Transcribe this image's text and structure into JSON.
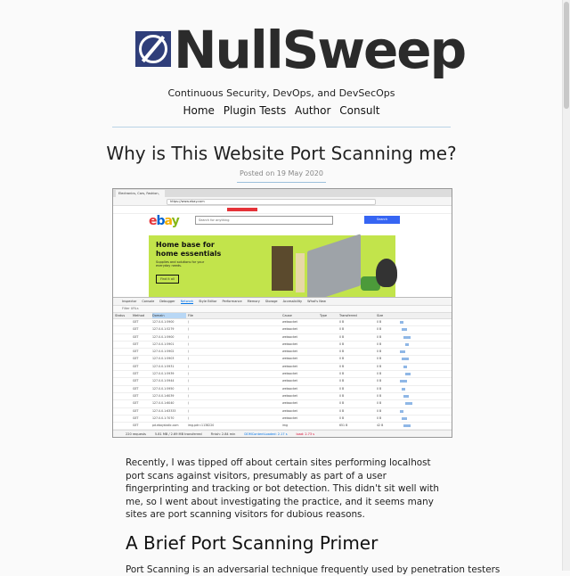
{
  "site": {
    "name": "NullSweep",
    "tagline": "Continuous Security, DevOps, and DevSecOps",
    "nav": [
      "Home",
      "Plugin Tests",
      "Author",
      "Consult"
    ]
  },
  "post": {
    "title": "Why is This Website Port Scanning me?",
    "date": "Posted on 19 May 2020",
    "intro": "Recently, I was tipped off about certain sites performing localhost port scans against visitors, presumably as part of a user fingerprinting and tracking or bot detection. This didn't sit well with me, so I went about investigating the practice, and it seems many sites are port scanning visitors for dubious reasons.",
    "section_heading": "A Brief Port Scanning Primer",
    "section_intro_partial": "Port Scanning is an adversarial technique frequently used by penetration testers"
  },
  "screenshot": {
    "tab_title": "Electronics, Cars, Fashion, Col...",
    "url": "https://www.ebay.com",
    "search_placeholder": "Search for anything",
    "search_button": "Search",
    "register_label": "Don't miss out: R 10 on",
    "banner_heading_1": "Home base for",
    "banner_heading_2": "home essentials",
    "banner_sub": "Supplies and solutions for your everyday needs.",
    "banner_cta": "Find it all",
    "devtools_tabs": [
      "Inspector",
      "Console",
      "Debugger",
      "Network",
      "Style Editor",
      "Performance",
      "Memory",
      "Storage",
      "Accessibility",
      "What's New"
    ],
    "filter_placeholder": "Filter URLs",
    "columns": [
      "Status",
      "Method",
      "Domain",
      "File",
      "Cause",
      "Type",
      "Transferred",
      "Size"
    ],
    "rows": [
      {
        "method": "GET",
        "domain": "127.0.0.1:5900",
        "file": "/",
        "cause": "websocket",
        "trans": "0 B",
        "size": "0 B"
      },
      {
        "method": "GET",
        "domain": "127.0.0.1:5279",
        "file": "/",
        "cause": "websocket",
        "trans": "0 B",
        "size": "0 B"
      },
      {
        "method": "GET",
        "domain": "127.0.0.1:5900",
        "file": "/",
        "cause": "websocket",
        "trans": "0 B",
        "size": "0 B"
      },
      {
        "method": "GET",
        "domain": "127.0.0.1:5901",
        "file": "/",
        "cause": "websocket",
        "trans": "0 B",
        "size": "0 B"
      },
      {
        "method": "GET",
        "domain": "127.0.0.1:5902",
        "file": "/",
        "cause": "websocket",
        "trans": "0 B",
        "size": "0 B"
      },
      {
        "method": "GET",
        "domain": "127.0.0.1:5903",
        "file": "/",
        "cause": "websocket",
        "trans": "0 B",
        "size": "0 B"
      },
      {
        "method": "GET",
        "domain": "127.0.0.1:5931",
        "file": "/",
        "cause": "websocket",
        "trans": "0 B",
        "size": "0 B"
      },
      {
        "method": "GET",
        "domain": "127.0.0.1:5939",
        "file": "/",
        "cause": "websocket",
        "trans": "0 B",
        "size": "0 B"
      },
      {
        "method": "GET",
        "domain": "127.0.0.1:5944",
        "file": "/",
        "cause": "websocket",
        "trans": "0 B",
        "size": "0 B"
      },
      {
        "method": "GET",
        "domain": "127.0.0.1:5950",
        "file": "/",
        "cause": "websocket",
        "trans": "0 B",
        "size": "0 B"
      },
      {
        "method": "GET",
        "domain": "127.0.0.1:6039",
        "file": "/",
        "cause": "websocket",
        "trans": "0 B",
        "size": "0 B"
      },
      {
        "method": "GET",
        "domain": "127.0.0.1:6040",
        "file": "/",
        "cause": "websocket",
        "trans": "0 B",
        "size": "0 B"
      },
      {
        "method": "GET",
        "domain": "127.0.0.1:63333",
        "file": "/",
        "cause": "websocket",
        "trans": "0 B",
        "size": "0 B"
      },
      {
        "method": "GET",
        "domain": "127.0.0.1:7070",
        "file": "/",
        "cause": "websocket",
        "trans": "0 B",
        "size": "0 B"
      },
      {
        "method": "GET",
        "domain": "pd.ebaystatic.com",
        "file": "img.pdr=1138220",
        "cause": "img",
        "trans": "651 B",
        "size": "42 B"
      }
    ],
    "status_bar": [
      "220 requests",
      "5.81 MB / 2.69 MB transferred",
      "Finish: 2.84 min",
      "DOMContentLoaded: 2.17 s",
      "load: 2.73 s"
    ]
  }
}
